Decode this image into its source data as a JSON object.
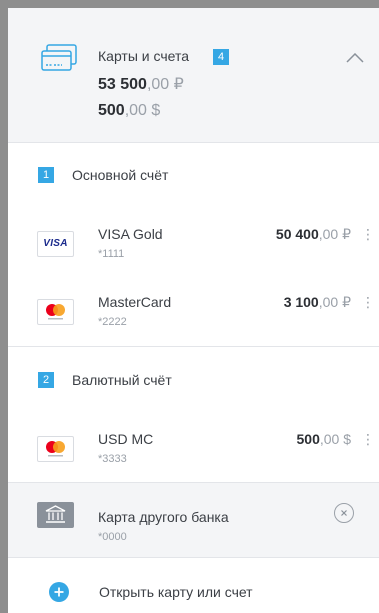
{
  "header": {
    "title": "Карты и счета",
    "count": "4",
    "total_rub_whole": "53 500",
    "total_rub_frac": ",00 ₽",
    "total_usd_whole": "500",
    "total_usd_frac": ",00 $"
  },
  "sections": [
    {
      "number": "1",
      "title": "Основной счёт",
      "cards": [
        {
          "name": "VISA Gold",
          "number": "*1111",
          "amount_whole": "50 400",
          "amount_frac": ",00 ₽",
          "logo": "visa-icon",
          "logo_text": "VISA"
        },
        {
          "name": "MasterCard",
          "number": "*2222",
          "amount_whole": "3 100",
          "amount_frac": ",00 ₽",
          "logo": "mastercard-icon"
        }
      ]
    },
    {
      "number": "2",
      "title": "Валютный счёт",
      "cards": [
        {
          "name": "USD MC",
          "number": "*3333",
          "amount_whole": "500",
          "amount_frac": ",00 $",
          "logo": "mastercard-icon"
        }
      ]
    }
  ],
  "other_bank": {
    "name": "Карта другого банка",
    "number": "*0000",
    "icon": "bank-building-icon"
  },
  "open_card": {
    "label": "Открыть карту или счет",
    "icon": "plus-icon"
  },
  "menu_glyph": "⋮",
  "colors": {
    "accent": "#35a7e4",
    "mastercard_red": "#eb001b",
    "mastercard_orange": "#f79e1b",
    "visa_blue": "#1a2a8c"
  }
}
